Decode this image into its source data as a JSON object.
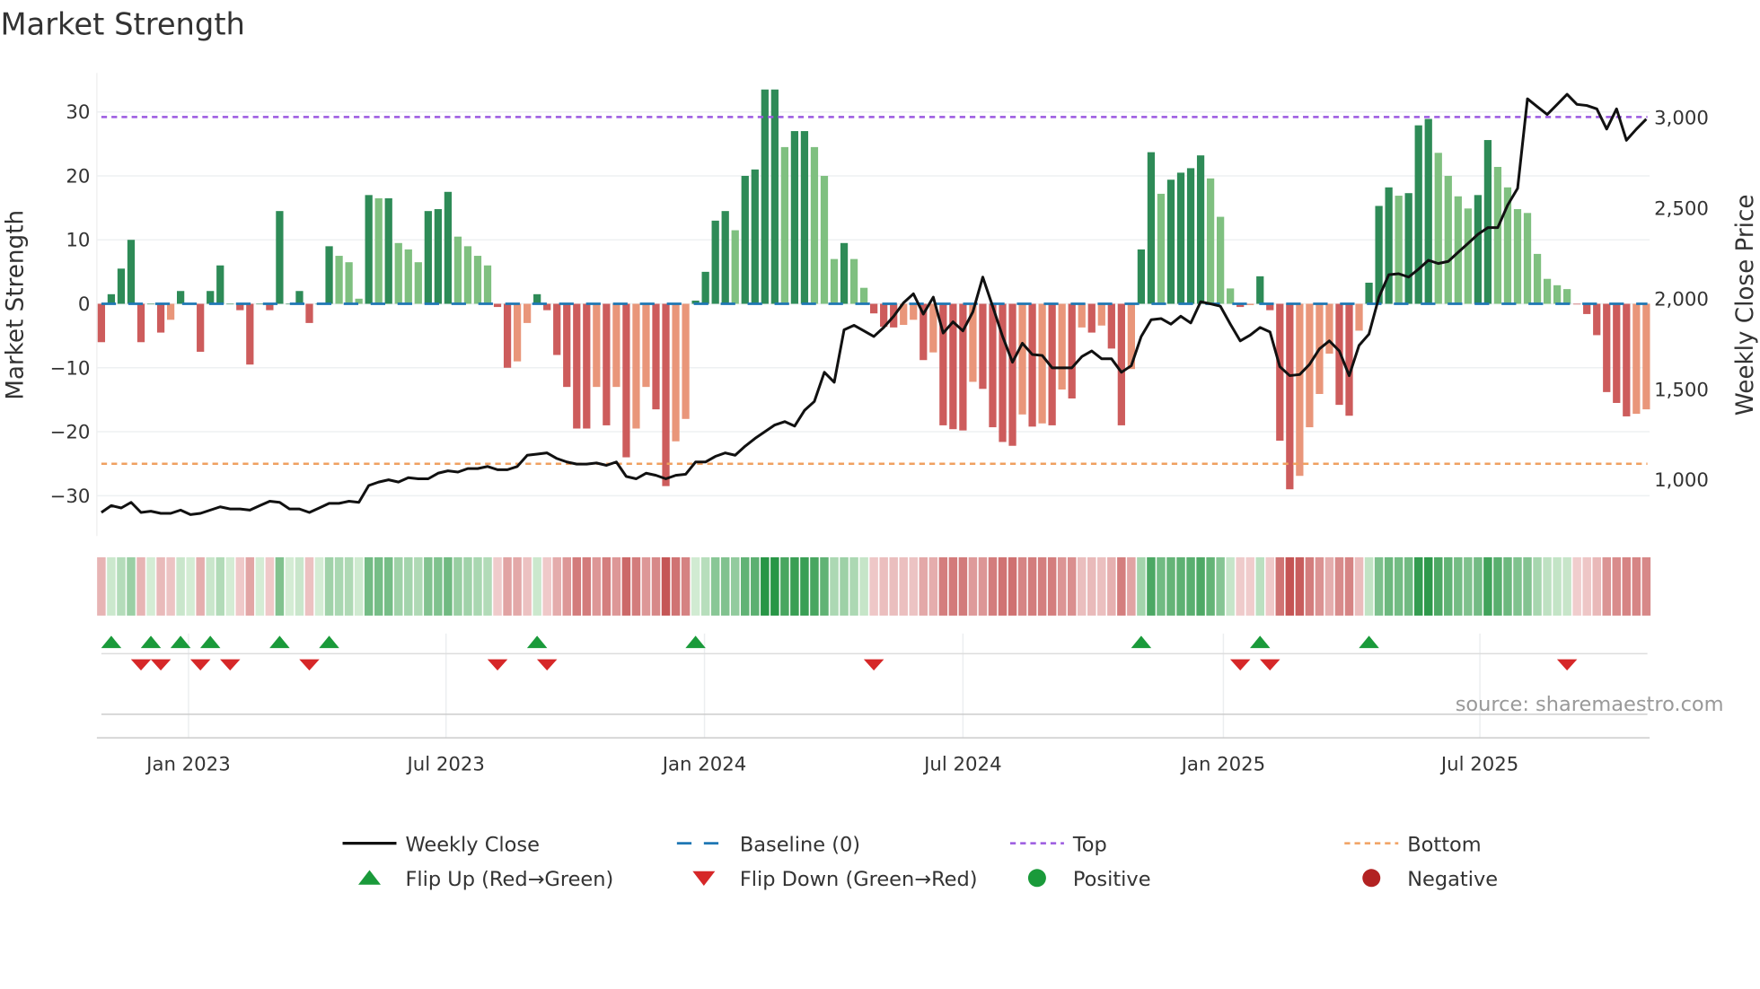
{
  "chart_data": {
    "type": "bar",
    "title": "Market Strength",
    "ylabel": "Market Strength",
    "y2label": "Weekly Close Price",
    "ylim": [
      -36.3,
      36.1
    ],
    "y2lim": [
      690,
      3248
    ],
    "yticks": [
      30,
      20,
      10,
      0,
      -10,
      -20,
      -30
    ],
    "yticklabels": [
      "30",
      "20",
      "10",
      "0",
      "−10",
      "−20",
      "−30"
    ],
    "y2ticks": [
      3000,
      2500,
      2000,
      1500,
      1000
    ],
    "y2ticklabels": [
      "3,000",
      "2,500",
      "2,000",
      "1,500",
      "1,000"
    ],
    "xticks": [
      {
        "label": "Jan 2023",
        "week_index": 8.8
      },
      {
        "label": "Jul 2023",
        "week_index": 34.8
      },
      {
        "label": "Jan 2024",
        "week_index": 60.9
      },
      {
        "label": "Jul 2024",
        "week_index": 87.0
      },
      {
        "label": "Jan 2025",
        "week_index": 113.3
      },
      {
        "label": "Jul 2025",
        "week_index": 139.2
      }
    ],
    "frequency": "weekly",
    "top_level": 29.2,
    "bottom_level": -25,
    "baseline": 0,
    "strength": [
      -6,
      1.5,
      5.5,
      10,
      -6,
      0,
      -4.5,
      -2.5,
      2,
      0,
      -7.5,
      2,
      6,
      0,
      -1,
      -9.5,
      0,
      -1,
      14.5,
      0,
      2,
      -3,
      0,
      9,
      7.5,
      6.5,
      0.8,
      17,
      16.5,
      16.5,
      9.5,
      8.5,
      6.5,
      14.5,
      14.8,
      17.5,
      10.5,
      9,
      7.5,
      6,
      -0.5,
      -10,
      -9,
      -3,
      1.5,
      -1,
      -8,
      -13,
      -19.5,
      -19.5,
      -13,
      -19,
      -13,
      -24,
      -19.5,
      -13,
      -16.5,
      -28.5,
      -21.5,
      -18,
      0.5,
      5,
      13,
      14.5,
      11.5,
      20,
      21,
      33.5,
      33.5,
      24.5,
      27,
      27,
      24.5,
      20,
      7,
      9.5,
      7,
      2.5,
      -1.5,
      -3.6,
      -3.7,
      -3.3,
      -2.5,
      -8.8,
      -7.6,
      -19,
      -19.6,
      -19.8,
      -12.2,
      -13.3,
      -19.3,
      -21.6,
      -22.2,
      -17.3,
      -19.2,
      -18.7,
      -19,
      -13.4,
      -14.8,
      -3.7,
      -4.5,
      -3.4,
      -7,
      -19,
      -10.2,
      8.5,
      23.7,
      17.2,
      19.4,
      20.5,
      21.2,
      23.2,
      19.6,
      13.6,
      2.4,
      -0.5,
      -0.2,
      4.3,
      -1,
      -21.4,
      -29,
      -26.9,
      -19.3,
      -14.1,
      -7.8,
      -15.8,
      -17.5,
      -4.2,
      3.3,
      15.3,
      18.2,
      16.9,
      17.3,
      27.9,
      28.9,
      23.6,
      20,
      16.8,
      14.9,
      17,
      25.6,
      21.4,
      18.2,
      14.8,
      14.2,
      7.8,
      3.9,
      2.9,
      2.3,
      -0.1,
      -1.6,
      -4.9,
      -13.8,
      -15.5,
      -17.6,
      -17.2,
      -16.5
    ],
    "weekly_close": [
      820,
      858,
      845,
      876,
      820,
      827,
      815,
      815,
      833,
      808,
      815,
      833,
      851,
      839,
      839,
      833,
      858,
      882,
      876,
      839,
      839,
      820,
      845,
      870,
      870,
      882,
      876,
      969,
      988,
      1000,
      988,
      1012,
      1006,
      1006,
      1037,
      1050,
      1043,
      1062,
      1062,
      1074,
      1056,
      1056,
      1074,
      1136,
      1142,
      1149,
      1118,
      1099,
      1087,
      1087,
      1093,
      1080,
      1099,
      1019,
      1006,
      1037,
      1025,
      1006,
      1025,
      1031,
      1099,
      1099,
      1130,
      1149,
      1136,
      1186,
      1229,
      1266,
      1303,
      1322,
      1297,
      1384,
      1433,
      1594,
      1539,
      1829,
      1854,
      1823,
      1792,
      1842,
      1904,
      1978,
      2028,
      1916,
      2009,
      1811,
      1873,
      1823,
      1928,
      2120,
      1959,
      1792,
      1650,
      1755,
      1693,
      1687,
      1619,
      1619,
      1619,
      1681,
      1712,
      1669,
      1669,
      1594,
      1631,
      1792,
      1885,
      1891,
      1860,
      1904,
      1867,
      1984,
      1972,
      1959,
      1860,
      1768,
      1799,
      1842,
      1817,
      1625,
      1576,
      1582,
      1638,
      1724,
      1768,
      1712,
      1576,
      1743,
      1805,
      2009,
      2133,
      2139,
      2120,
      2164,
      2213,
      2195,
      2207,
      2257,
      2306,
      2356,
      2393,
      2393,
      2517,
      2610,
      3105,
      3061,
      3018,
      3074,
      3130,
      3074,
      3068,
      3049,
      2938,
      3049,
      2876,
      2938,
      2993
    ],
    "flip_up_week_index": [
      1,
      5,
      8,
      11,
      18,
      23,
      44,
      60,
      105,
      117,
      128
    ],
    "flip_down_week_index": [
      4,
      6,
      10,
      13,
      21,
      40,
      45,
      78,
      115,
      118,
      148
    ],
    "legend": [
      {
        "label": "Weekly Close",
        "kind": "line",
        "color": "#111111"
      },
      {
        "label": "Baseline (0)",
        "kind": "dash",
        "color": "#1f77b4"
      },
      {
        "label": "Top",
        "kind": "dot",
        "color": "#9b59e0"
      },
      {
        "label": "Bottom",
        "kind": "dot",
        "color": "#f0a060"
      },
      {
        "label": "Flip Up (Red→Green)",
        "kind": "tri-up",
        "color": "#1a9a3a"
      },
      {
        "label": "Flip Down (Green→Red)",
        "kind": "tri-down",
        "color": "#d62728"
      },
      {
        "label": "Positive",
        "kind": "circle",
        "color": "#1a9a3a"
      },
      {
        "label": "Negative",
        "kind": "circle",
        "color": "#b22222"
      }
    ],
    "legend_position": "bottom-center",
    "colors": {
      "pos_strong": "#2e8b57",
      "pos_weak": "#7fc080",
      "neg_strong": "#cd5c5c",
      "neg_weak": "#e9967a"
    }
  },
  "source": "source: sharemaestro.com"
}
